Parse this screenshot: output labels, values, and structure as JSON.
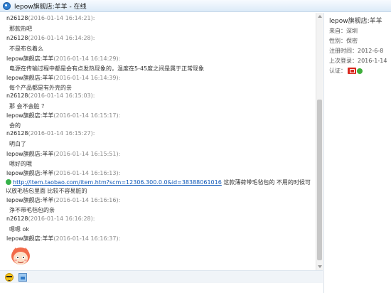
{
  "window": {
    "title": "lepow旗舰店:羊羊 - 在线"
  },
  "messages": [
    {
      "sender": "n26128",
      "time": "(2016-01-14 16:14:21):",
      "text": "那款热吧"
    },
    {
      "sender": "n26128",
      "time": "(2016-01-14 16:14:28):",
      "text": "不是布包着么"
    },
    {
      "sender": "lepow旗舰店:羊羊",
      "time": "(2016-01-14 16:14:29):",
      "text": "电源在传输过程中都是会有点发热现象的，温度在5-45度之间是属于正常现象"
    },
    {
      "sender": "lepow旗舰店:羊羊",
      "time": "(2016-01-14 16:14:39):",
      "text": "每个产品都是有外壳的亲"
    },
    {
      "sender": "n26128",
      "time": "(2016-01-14 16:15:03):",
      "text": "那 会不会脏 ？"
    },
    {
      "sender": "lepow旗舰店:羊羊",
      "time": "(2016-01-14 16:15:17):",
      "text": "会的"
    },
    {
      "sender": "n26128",
      "time": "(2016-01-14 16:15:27):",
      "text": "明白了"
    },
    {
      "sender": "lepow旗舰店:羊羊",
      "time": "(2016-01-14 16:15:51):",
      "text": "嗯好的哦"
    },
    {
      "sender": "lepow旗舰店:羊羊",
      "time": "(2016-01-14 16:16:13):",
      "link": "http://item.taobao.com/item.htm?scm=12306.300.0.0&id=38388061016",
      "text": " 这款薄荷带毛毡包的 不用的时候可以放毛毡包里面 比较不容易脏的"
    },
    {
      "sender": "lepow旗舰店:羊羊",
      "time": "(2016-01-14 16:16:16):",
      "text": "浄不带毛毡包的亲"
    },
    {
      "sender": "n26128",
      "time": "(2016-01-14 16:16:28):",
      "text": "嗯嗯 ok"
    },
    {
      "sender": "lepow旗舰店:羊羊",
      "time": "(2016-01-14 16:16:37):",
      "text": ""
    }
  ],
  "sidebar": {
    "name": "lepow旗舰店:羊羊",
    "from": {
      "label": "来自：",
      "value": "深圳"
    },
    "gender": {
      "label": "性别：",
      "value": "保密"
    },
    "registered": {
      "label": "注册时间：",
      "value": "2012-6-8"
    },
    "last_login": {
      "label": "上次登录：",
      "value": "2016-1-14"
    },
    "auth": {
      "label": "认证："
    }
  },
  "toolbar": {
    "icons": [
      "emoticon-icon",
      "image-icon"
    ]
  },
  "colors": {
    "link": "#0b56b7",
    "time": "#8a8a8a",
    "titlebar": "#dcebf8"
  }
}
